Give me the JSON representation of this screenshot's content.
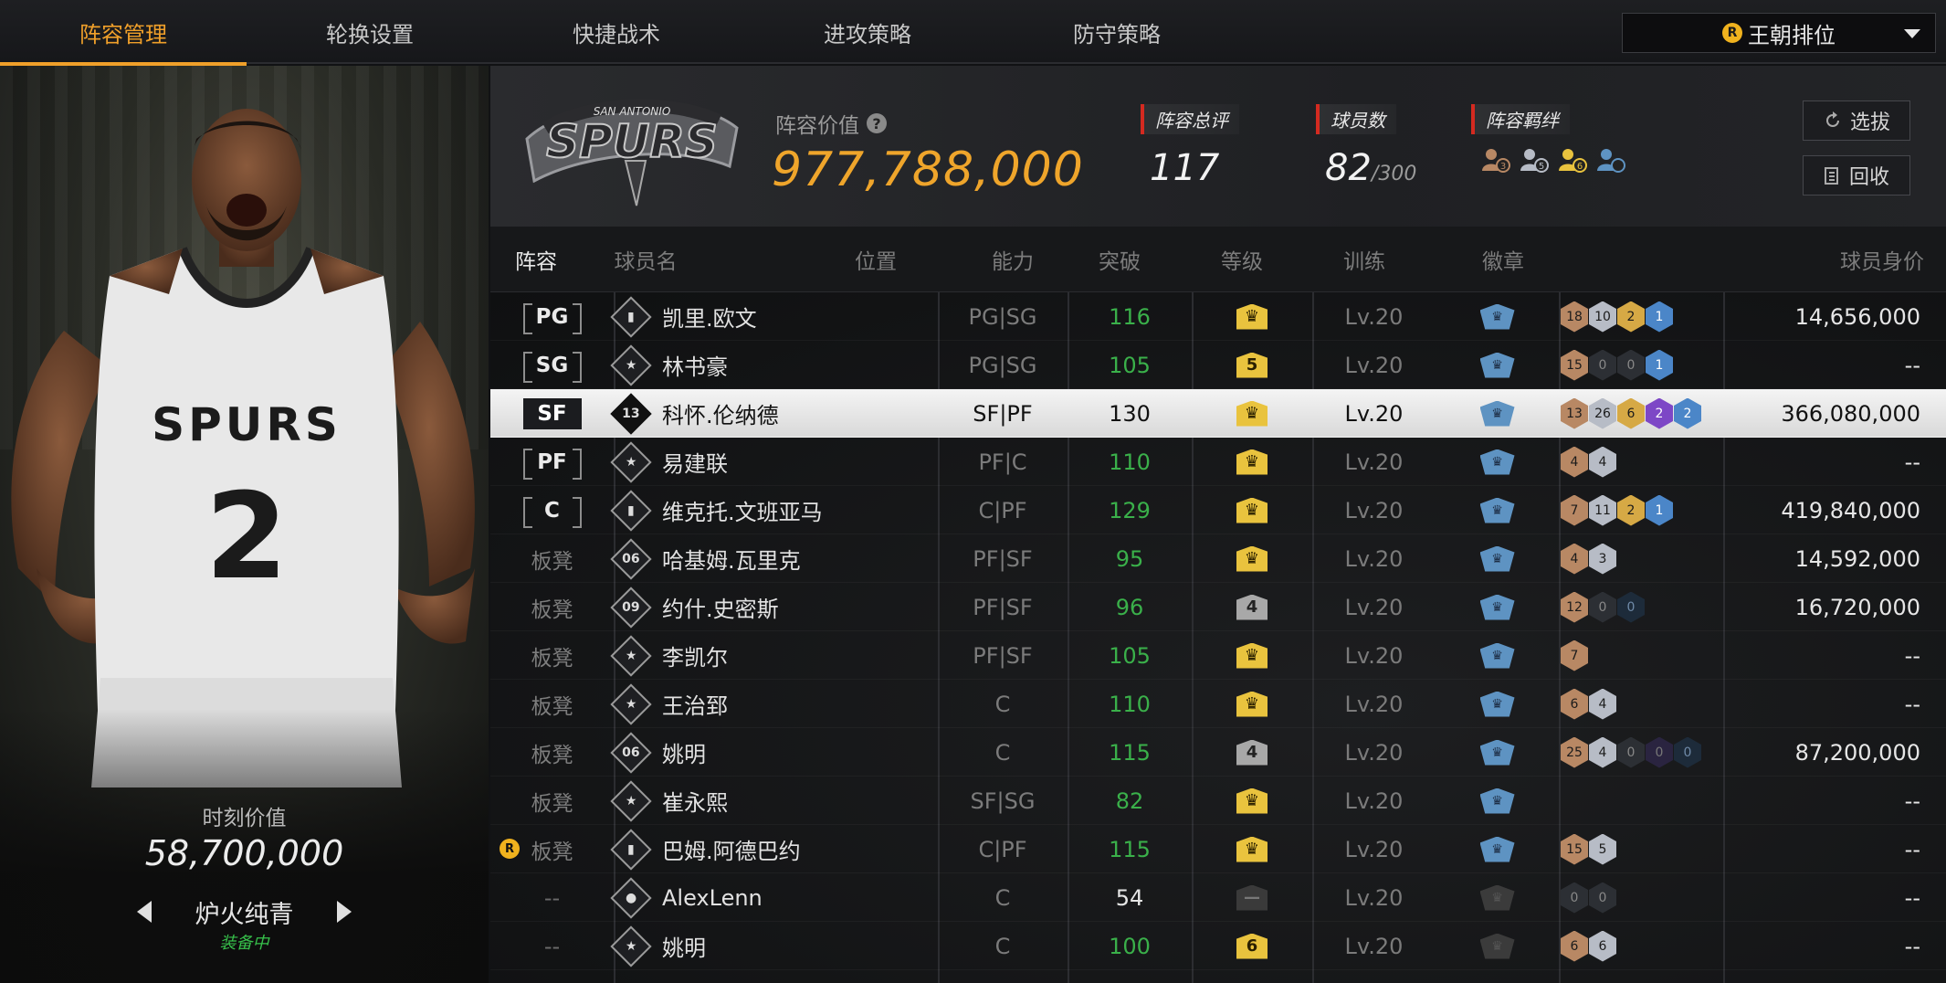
{
  "nav": {
    "tabs": [
      "阵容管理",
      "轮换设置",
      "快捷战术",
      "进攻策略",
      "防守策略"
    ],
    "active_tab": 0,
    "mode_select": "王朝排位"
  },
  "player_panel": {
    "jersey_team": "SPURS",
    "jersey_number": "2",
    "moment_label": "时刻价值",
    "moment_value": "58,700,000",
    "skin_name": "炉火纯青",
    "skin_status": "装备中"
  },
  "header": {
    "logo_text": "SPURS",
    "logo_arc": "SAN ANTONIO",
    "value_label": "阵容价值",
    "value": "977,788,000",
    "stats": [
      {
        "label": "阵容总评",
        "value": "117"
      },
      {
        "label": "球员数",
        "value": "82",
        "suffix": "/300"
      },
      {
        "label": "阵容羁绊"
      }
    ],
    "bond_icons": [
      {
        "icon": "bond-bronze-icon",
        "color": "#b88864",
        "level": "3"
      },
      {
        "icon": "bond-silver-icon",
        "color": "#b7bcc6",
        "level": "5"
      },
      {
        "icon": "bond-gold-icon",
        "color": "#e9c33e",
        "level": "6"
      },
      {
        "icon": "bond-blue-icon",
        "color": "#5e93c2",
        "level": ""
      }
    ],
    "buttons": {
      "draft": "选拔",
      "recycle": "回收"
    }
  },
  "table": {
    "headers": [
      "阵容",
      "球员名",
      "位置",
      "能力",
      "突破",
      "等级",
      "训练",
      "徽章",
      "球员身价"
    ],
    "rows": [
      {
        "slot": "PG",
        "slot_type": "starter",
        "tier": "bars",
        "name": "凯里.欧文",
        "position": "PG|SG",
        "ability": "116",
        "ability_color": "green",
        "break": "crown",
        "break_style": "gold",
        "level": "Lv.20",
        "train": "on",
        "badges": [
          [
            "b-bronze",
            "18"
          ],
          [
            "b-silver",
            "10"
          ],
          [
            "b-gold",
            "2"
          ],
          [
            "b-blue",
            "1"
          ]
        ],
        "value": "14,656,000"
      },
      {
        "slot": "SG",
        "slot_type": "starter",
        "tier": "star",
        "name": "林书豪",
        "position": "PG|SG",
        "ability": "105",
        "ability_color": "green",
        "break": "5",
        "break_style": "gold",
        "level": "Lv.20",
        "train": "on",
        "badges": [
          [
            "b-bronze",
            "15"
          ],
          [
            "b-empty",
            "0"
          ],
          [
            "b-empty",
            "0"
          ],
          [
            "b-blue",
            "1"
          ]
        ],
        "value": "--"
      },
      {
        "slot": "SF",
        "slot_type": "starter",
        "tier": "13",
        "name": "科怀.伦纳德",
        "position": "SF|PF",
        "ability": "130",
        "ability_color": "white",
        "break": "crown",
        "break_style": "gold",
        "level": "Lv.20",
        "train": "on",
        "badges": [
          [
            "b-bronze",
            "13"
          ],
          [
            "b-silver",
            "26"
          ],
          [
            "b-gold",
            "6"
          ],
          [
            "b-purple",
            "2"
          ],
          [
            "b-blue",
            "2"
          ]
        ],
        "value": "366,080,000",
        "selected": true
      },
      {
        "slot": "PF",
        "slot_type": "starter",
        "tier": "star",
        "name": "易建联",
        "position": "PF|C",
        "ability": "110",
        "ability_color": "green",
        "break": "crown",
        "break_style": "gold",
        "level": "Lv.20",
        "train": "on",
        "badges": [
          [
            "b-bronze",
            "4"
          ],
          [
            "b-silver",
            "4"
          ]
        ],
        "value": "--"
      },
      {
        "slot": "C",
        "slot_type": "starter",
        "tier": "bars",
        "name": "维克托.文班亚马",
        "position": "C|PF",
        "ability": "129",
        "ability_color": "green",
        "break": "crown",
        "break_style": "gold",
        "level": "Lv.20",
        "train": "on",
        "badges": [
          [
            "b-bronze",
            "7"
          ],
          [
            "b-silver",
            "11"
          ],
          [
            "b-gold",
            "2"
          ],
          [
            "b-blue",
            "1"
          ]
        ],
        "value": "419,840,000"
      },
      {
        "slot": "板凳",
        "slot_type": "bench",
        "tier": "06",
        "name": "哈基姆.瓦里克",
        "position": "PF|SF",
        "ability": "95",
        "ability_color": "green",
        "break": "crown",
        "break_style": "gold",
        "level": "Lv.20",
        "train": "on",
        "badges": [
          [
            "b-bronze",
            "4"
          ],
          [
            "b-silver",
            "3"
          ]
        ],
        "value": "14,592,000"
      },
      {
        "slot": "板凳",
        "slot_type": "bench",
        "tier": "09",
        "name": "约什.史密斯",
        "position": "PF|SF",
        "ability": "96",
        "ability_color": "green",
        "break": "4",
        "break_style": "grey",
        "level": "Lv.20",
        "train": "on",
        "badges": [
          [
            "b-bronze",
            "12"
          ],
          [
            "b-empty",
            "0"
          ],
          [
            "b-empty-blue",
            "0"
          ]
        ],
        "value": "16,720,000"
      },
      {
        "slot": "板凳",
        "slot_type": "bench",
        "tier": "star",
        "name": "李凯尔",
        "position": "PF|SF",
        "ability": "105",
        "ability_color": "green",
        "break": "crown",
        "break_style": "gold",
        "level": "Lv.20",
        "train": "on",
        "badges": [
          [
            "b-bronze",
            "7"
          ]
        ],
        "value": "--"
      },
      {
        "slot": "板凳",
        "slot_type": "bench",
        "tier": "star",
        "name": "王治郅",
        "position": "C",
        "ability": "110",
        "ability_color": "green",
        "break": "crown",
        "break_style": "gold",
        "level": "Lv.20",
        "train": "on",
        "badges": [
          [
            "b-bronze",
            "6"
          ],
          [
            "b-silver",
            "4"
          ]
        ],
        "value": "--"
      },
      {
        "slot": "板凳",
        "slot_type": "bench",
        "tier": "06",
        "name": "姚明",
        "position": "C",
        "ability": "115",
        "ability_color": "green",
        "break": "4",
        "break_style": "grey",
        "level": "Lv.20",
        "train": "on",
        "badges": [
          [
            "b-bronze",
            "25"
          ],
          [
            "b-silver",
            "4"
          ],
          [
            "b-empty",
            "0"
          ],
          [
            "b-empty-dark",
            "0"
          ],
          [
            "b-empty-blue",
            "0"
          ]
        ],
        "value": "87,200,000"
      },
      {
        "slot": "板凳",
        "slot_type": "bench",
        "tier": "star",
        "name": "崔永熙",
        "position": "SF|SG",
        "ability": "82",
        "ability_color": "green",
        "break": "crown",
        "break_style": "gold",
        "level": "Lv.20",
        "train": "on",
        "badges": [],
        "value": "--"
      },
      {
        "slot": "板凳",
        "slot_type": "bench",
        "tier": "bars",
        "name": "巴姆.阿德巴约",
        "position": "C|PF",
        "ability": "115",
        "ability_color": "green",
        "break": "crown",
        "break_style": "gold",
        "level": "Lv.20",
        "train": "on",
        "badges": [
          [
            "b-bronze",
            "15"
          ],
          [
            "b-silver",
            "5"
          ]
        ],
        "value": "--",
        "locked": true
      },
      {
        "slot": "--",
        "slot_type": "none",
        "tier": "person",
        "name": "AlexLenn",
        "position": "C",
        "ability": "54",
        "ability_color": "white",
        "break": "—",
        "break_style": "dark",
        "level": "Lv.20",
        "train": "off",
        "badges": [
          [
            "b-empty",
            "0"
          ],
          [
            "b-empty",
            "0"
          ]
        ],
        "value": "--"
      },
      {
        "slot": "--",
        "slot_type": "none",
        "tier": "star",
        "name": "姚明",
        "position": "C",
        "ability": "100",
        "ability_color": "green",
        "break": "6",
        "break_style": "gold",
        "level": "Lv.20",
        "train": "off",
        "badges": [
          [
            "b-bronze",
            "6"
          ],
          [
            "b-silver",
            "6"
          ]
        ],
        "value": "--"
      }
    ]
  }
}
